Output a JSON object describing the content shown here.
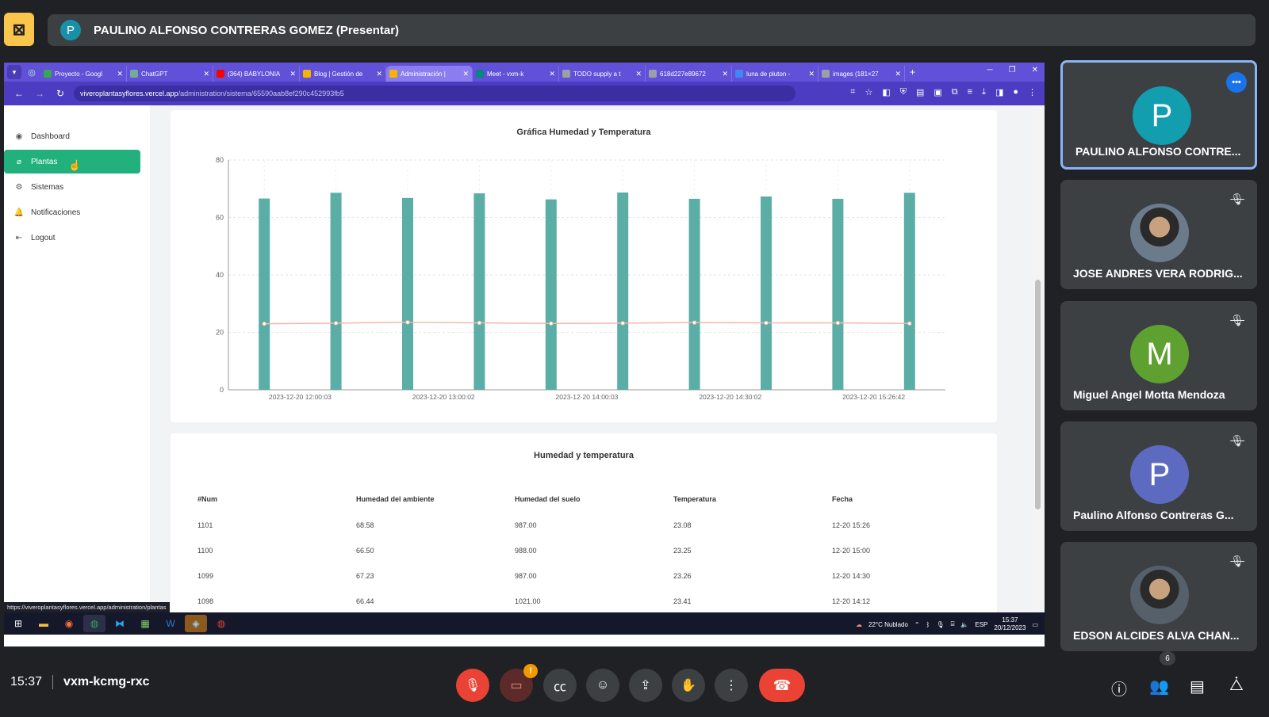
{
  "meet": {
    "presenter_name": "PAULINO ALFONSO CONTRERAS GOMEZ (Presentar)",
    "presenter_initial": "P",
    "time": "15:37",
    "meeting_code": "vxm-kcmg-rxc",
    "people_count": "6",
    "warning_badge": "!"
  },
  "browser": {
    "tabs": [
      {
        "title": "Proyecto - Googl",
        "color": "#34a853"
      },
      {
        "title": "ChatGPT",
        "color": "#74aa9c"
      },
      {
        "title": "(364) BABYLONIA",
        "color": "#ff0000"
      },
      {
        "title": "Blog | Gestión de",
        "color": "#f4b400"
      },
      {
        "title": "Administración |",
        "color": "#f4b400"
      },
      {
        "title": "Meet - vxm-k",
        "color": "#00897b"
      },
      {
        "title": "TODO supply a t",
        "color": "#9aa0a6"
      },
      {
        "title": "618d227e89672",
        "color": "#9aa0a6"
      },
      {
        "title": "luna de pluton -",
        "color": "#4285f4"
      },
      {
        "title": "images (181×27",
        "color": "#9aa0a6"
      }
    ],
    "active_tab_index": 4,
    "url_host": "viveroplantasyflores.vercel.app",
    "url_path": "/administration/sistema/65590aab8ef290c452993fb5",
    "status_url": "https://viveroplantasyflores.vercel.app/administration/plantas"
  },
  "sidebar": {
    "items": [
      {
        "label": "Dashboard",
        "icon": "dashboard-icon",
        "glyph": "◉"
      },
      {
        "label": "Plantas",
        "icon": "leaf-icon",
        "glyph": "⌀"
      },
      {
        "label": "Sistemas",
        "icon": "gear-icon",
        "glyph": "⚙"
      },
      {
        "label": "Notificaciones",
        "icon": "bell-icon",
        "glyph": "🔔"
      },
      {
        "label": "Logout",
        "icon": "logout-icon",
        "glyph": "⇤"
      }
    ],
    "active_index": 1
  },
  "chart_data": {
    "type": "bar",
    "title": "Gráfica Humedad y Temperatura",
    "categories": [
      "2023-12-20 12:00:03",
      "",
      "2023-12-20 13:00:02",
      "",
      "2023-12-20 14:00:03",
      "",
      "2023-12-20 14:30:02",
      "",
      "2023-12-20 15:26:42"
    ],
    "series": [
      {
        "kind": "bar",
        "color": "#5aaea6",
        "values": [
          66.6,
          68.6,
          66.8,
          68.4,
          66.3,
          68.7,
          66.5,
          67.3,
          66.5,
          68.6
        ]
      },
      {
        "kind": "line",
        "color": "#f4b8a8",
        "values": [
          23.0,
          23.2,
          23.5,
          23.3,
          23.1,
          23.2,
          23.4,
          23.3,
          23.3,
          23.1
        ]
      }
    ],
    "xlabel": "",
    "ylabel": "",
    "ylim": [
      0,
      80
    ],
    "yticks": [
      0,
      20,
      40,
      60,
      80
    ],
    "grid": true
  },
  "table": {
    "title": "Humedad y temperatura",
    "headers": [
      "#Num",
      "Humedad del ambiente",
      "Humedad del suelo",
      "Temperatura",
      "Fecha"
    ],
    "rows": [
      [
        "1101",
        "68.58",
        "987.00",
        "23.08",
        "12-20 15:26"
      ],
      [
        "1100",
        "66.50",
        "988.00",
        "23.25",
        "12-20 15:00"
      ],
      [
        "1099",
        "67.23",
        "987.00",
        "23.26",
        "12-20 14:30"
      ],
      [
        "1098",
        "66.44",
        "1021.00",
        "23.41",
        "12-20 14:12"
      ]
    ]
  },
  "taskbar": {
    "weather": "22°C  Nublado",
    "lang": "ESP",
    "clock_time": "15:37",
    "clock_date": "20/12/2023"
  },
  "participants": [
    {
      "name": "PAULINO ALFONSO CONTRE...",
      "initial": "P",
      "color": "#129eaf",
      "type": "initial",
      "speaking": true
    },
    {
      "name": "JOSE ANDRES VERA RODRIG...",
      "initial": "",
      "color": "#6b7b8c",
      "type": "photo",
      "speaking": false
    },
    {
      "name": "Miguel Angel Motta Mendoza",
      "initial": "M",
      "color": "#5fa130",
      "type": "initial",
      "speaking": false
    },
    {
      "name": "Paulino Alfonso Contreras G...",
      "initial": "P",
      "color": "#5c6bc0",
      "type": "initial",
      "speaking": false
    },
    {
      "name": "EDSON ALCIDES ALVA CHAN...",
      "initial": "",
      "color": "#55606b",
      "type": "photo",
      "speaking": false
    }
  ]
}
